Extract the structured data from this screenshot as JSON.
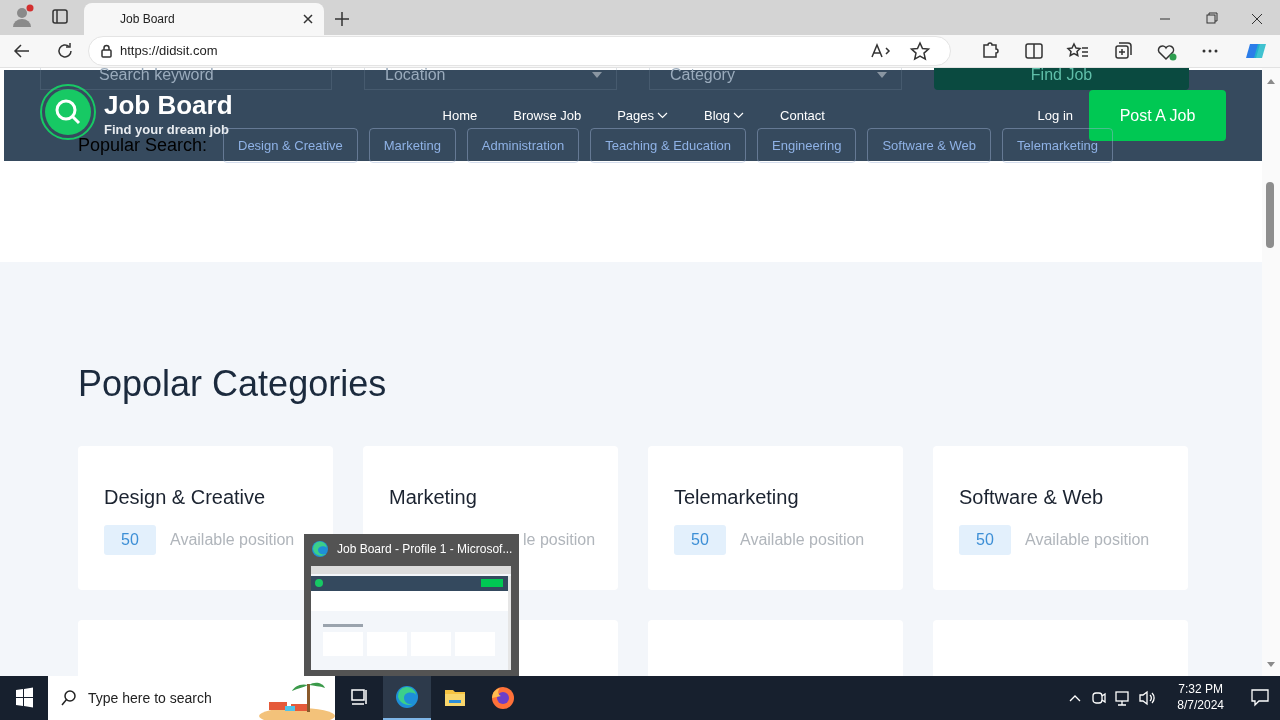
{
  "browser": {
    "tabs": [
      {
        "title": "Job Board",
        "selected": true
      }
    ],
    "url": "https://didsit.com"
  },
  "search_form": {
    "keyword_placeholder": "Search keyword",
    "location_placeholder": "Location",
    "category_placeholder": "Category",
    "button": "Find Job"
  },
  "popular_search": {
    "label": "Popular Search:",
    "tags": [
      "Design & Creative",
      "Marketing",
      "Administration",
      "Teaching & Education",
      "Engineering",
      "Software & Web",
      "Telemarketing"
    ]
  },
  "header": {
    "brand": "Job Board",
    "tagline": "Find your dream job",
    "nav": [
      {
        "label": "Home",
        "dropdown": false
      },
      {
        "label": "Browse Job",
        "dropdown": false
      },
      {
        "label": "Pages",
        "dropdown": true
      },
      {
        "label": "Blog",
        "dropdown": true
      },
      {
        "label": "Contact",
        "dropdown": false
      }
    ],
    "login": "Log in",
    "post_button": "Post A Job"
  },
  "categories": {
    "title": "Popolar Categories",
    "items": [
      {
        "kind": "full",
        "name": "Design & Creative",
        "count": "50",
        "count_label": "Available position"
      },
      {
        "kind": "full",
        "name": "Marketing",
        "count_label": "le position"
      },
      {
        "kind": "full",
        "name": "Telemarketing",
        "count": "50",
        "count_label": "Available position"
      },
      {
        "kind": "full",
        "name": "Software & Web",
        "count": "50",
        "count_label": "Available position"
      },
      {
        "kind": "cut"
      },
      {
        "kind": "cut"
      },
      {
        "kind": "cut"
      },
      {
        "kind": "cut"
      }
    ]
  },
  "taskbar_preview": {
    "title": "Job Board - Profile 1 - Microsof..."
  },
  "taskbar": {
    "search_placeholder": "Type here to search",
    "time": "7:32 PM",
    "date": "8/7/2024"
  }
}
